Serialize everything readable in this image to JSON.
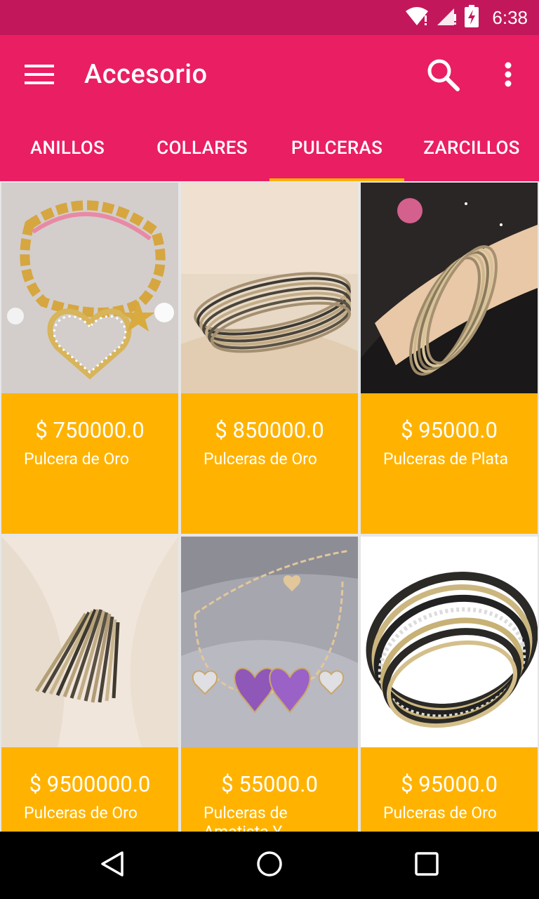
{
  "status": {
    "time": "6:38"
  },
  "app_bar": {
    "title": "Accesorio"
  },
  "tabs": [
    {
      "label": "ANILLOS"
    },
    {
      "label": "COLLARES"
    },
    {
      "label": "PULCERAS",
      "active": true
    },
    {
      "label": "ZARCILLOS"
    }
  ],
  "products": [
    {
      "price": "$ 750000.0",
      "name": "Pulcera de Oro"
    },
    {
      "price": "$ 850000.0",
      "name": "Pulceras de Oro"
    },
    {
      "price": "$ 95000.0",
      "name": "Pulceras de Plata"
    },
    {
      "price": "$ 9500000.0",
      "name": "Pulceras de Oro"
    },
    {
      "price": "$ 55000.0",
      "name": "Pulceras de Amatista Y"
    },
    {
      "price": "$ 95000.0",
      "name": "Pulceras de Oro"
    }
  ],
  "colors": {
    "status_bar": "#c2185b",
    "app_bar": "#ea1e63",
    "tab_indicator": "#ffb300",
    "card_footer": "#ffb300"
  }
}
